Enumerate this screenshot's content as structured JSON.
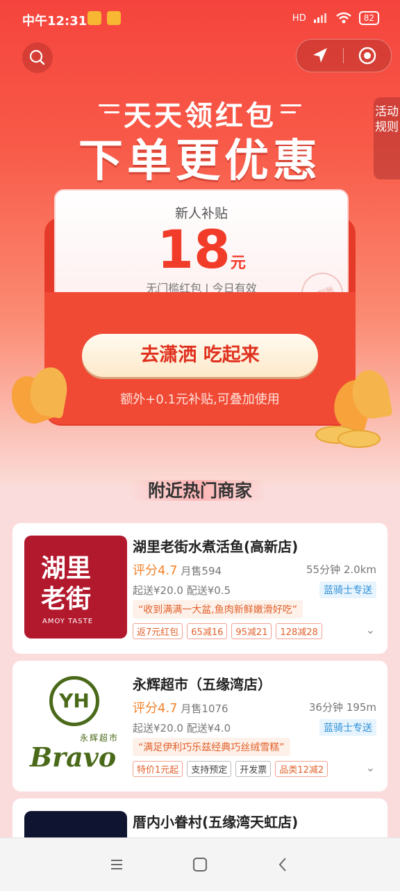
{
  "status_bar": {
    "time": "中午12:31",
    "network": "HD",
    "battery": "82"
  },
  "side_tab": "活动规则",
  "banner": {
    "title": "天天领红包",
    "subtitle": "下单更优惠"
  },
  "coupon": {
    "label": "新人补贴",
    "amount": "18",
    "unit": "元",
    "desc": "无门槛红包 | 今日有效",
    "stamp": "已到账",
    "cta": "去潇洒 吃起来",
    "extra": "额外+0.1元补贴,可叠加使用"
  },
  "section_title": "附近热门商家",
  "shops": [
    {
      "name": "湖里老街水煮活鱼(高新店)",
      "logo_text": [
        "湖里",
        "老街"
      ],
      "logo_sub": "AMOY TASTE",
      "rating": "评分4.7",
      "sales": "月售594",
      "eta": "55分钟 2.0km",
      "min_order": "起送¥20.0 配送¥0.5",
      "rider": "蓝骑士专送",
      "quote": "“收到满满一大盆,鱼肉新鲜嫩滑好吃”",
      "tags": [
        "返7元红包",
        "65减16",
        "95减21",
        "128减28"
      ]
    },
    {
      "name": "永辉超市（五缘湾店）",
      "logo_text": [
        "YH",
        "Bravo"
      ],
      "logo_sub": "永辉超市",
      "rating": "评分4.7",
      "sales": "月售1076",
      "eta": "36分钟 195m",
      "min_order": "起送¥20.0 配送¥4.0",
      "rider": "蓝骑士专送",
      "quote": "“满足伊利巧乐兹经典巧丝绒雪糕”",
      "tags": [
        "特价1元起",
        "支持预定",
        "开发票",
        "品类12减2"
      ]
    },
    {
      "name": "厝内小眷村(五缘湾天虹店)"
    }
  ],
  "colors": {
    "primary": "#f23c2a",
    "rider_blue": "#2d8fd8",
    "rating_orange": "#f2832b"
  }
}
